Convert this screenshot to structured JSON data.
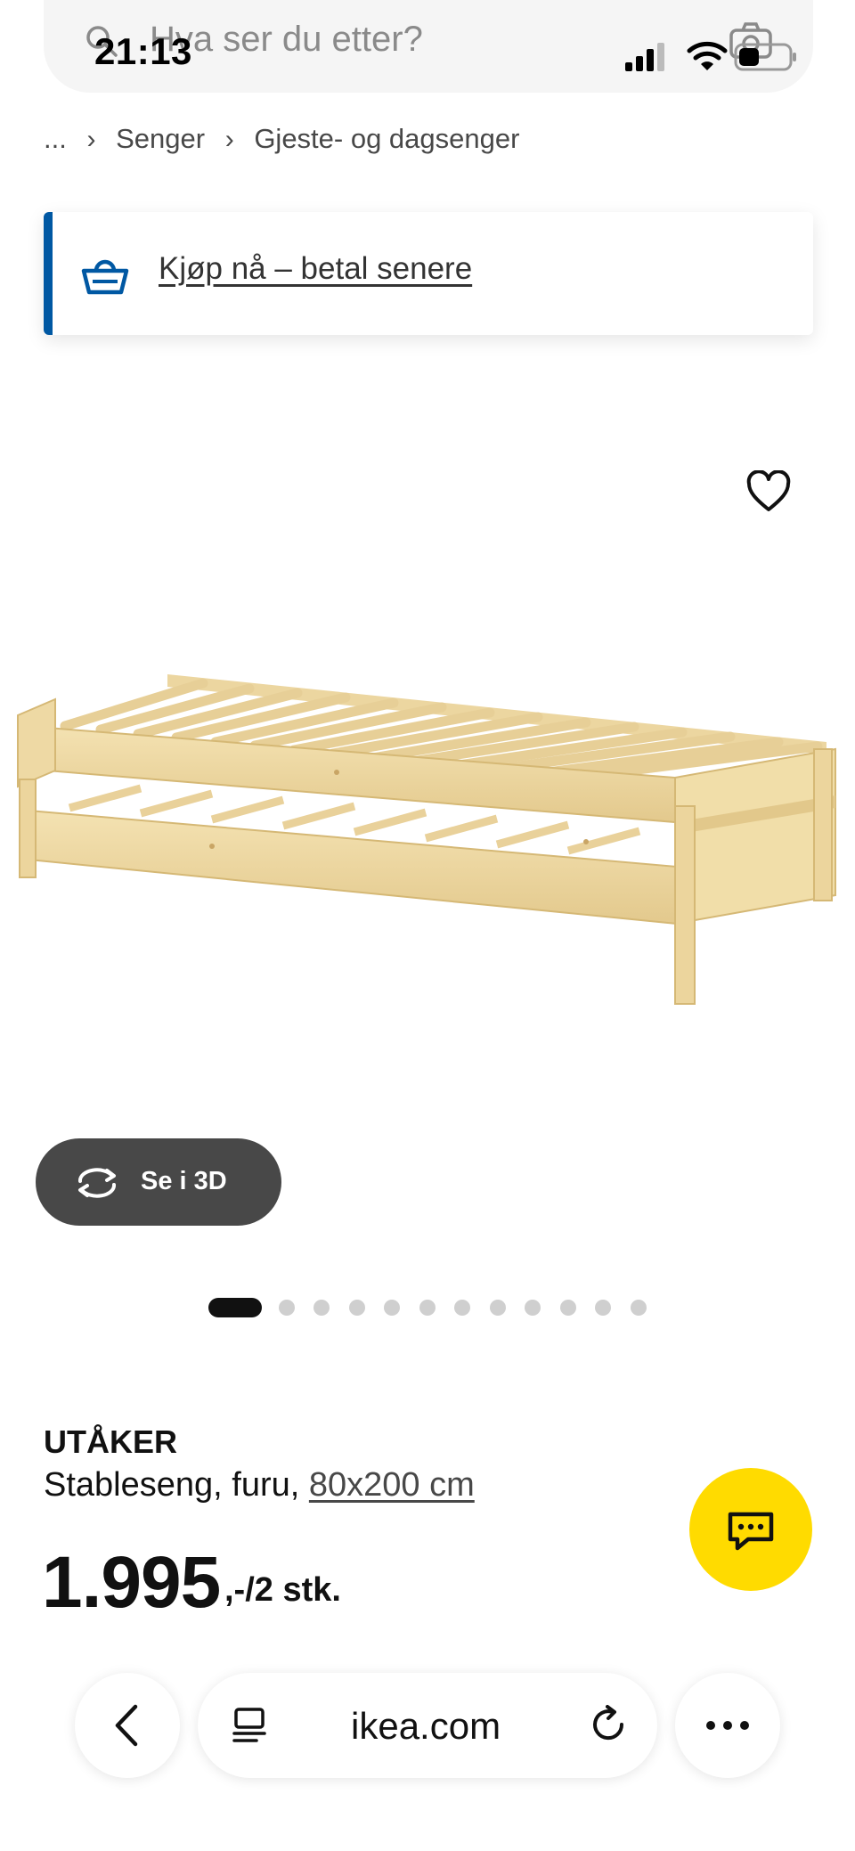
{
  "status_bar": {
    "time": "21:13",
    "icons": [
      "signal-icon",
      "wifi-icon",
      "battery-icon"
    ]
  },
  "search": {
    "placeholder": "Hva ser du etter?",
    "icons": [
      "search-icon",
      "camera-icon"
    ]
  },
  "breadcrumb": {
    "ellipsis": "...",
    "items": [
      "Senger",
      "Gjeste- og dagsenger"
    ]
  },
  "bnpl": {
    "label": "Kjøp nå – betal senere",
    "icon": "basket-icon",
    "accent": "#0058a3"
  },
  "gallery": {
    "favorite_icon": "heart-icon",
    "see_3d_label": "Se i 3D",
    "see_3d_icon": "rotate-3d-icon",
    "dot_count": 13,
    "active_dot": 1
  },
  "product": {
    "name": "UTÅKER",
    "description_prefix": "Stableseng, furu,",
    "size": "80x200 cm",
    "price_main": "1.995",
    "price_suffix": ",-/2 stk."
  },
  "chat": {
    "icon": "chat-icon",
    "color": "#ffdb00"
  },
  "browser_bar": {
    "url": "ikea.com",
    "icons": [
      "back-icon",
      "reader-icon",
      "reload-icon",
      "more-icon"
    ]
  }
}
